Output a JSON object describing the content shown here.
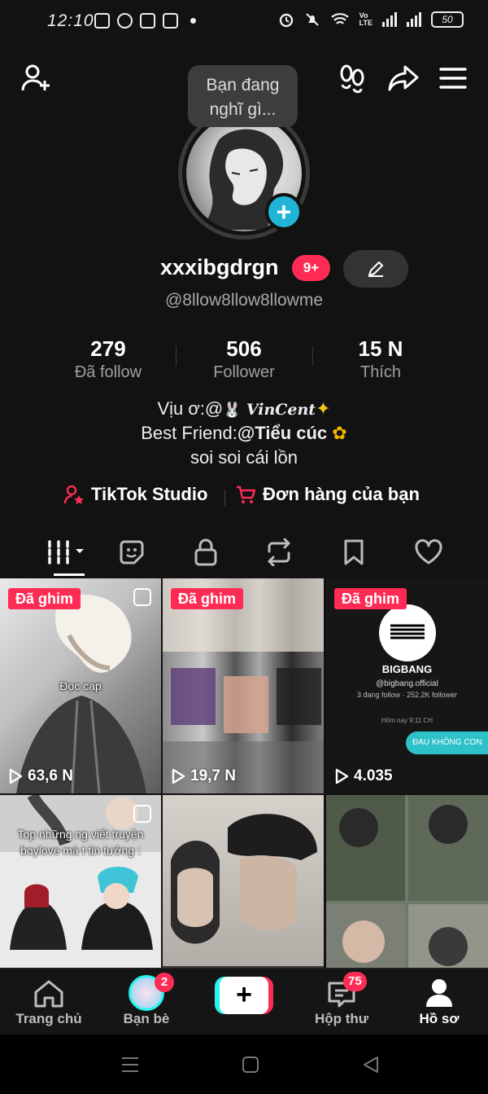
{
  "status_bar": {
    "time": "12:10",
    "volte": "Vo\nLTE",
    "battery": "50",
    "icons": [
      "chat-icon",
      "facebook-icon",
      "facebook-icon",
      "facebook-icon",
      "dot-icon",
      "alarm-icon",
      "mute-icon",
      "wifi-icon",
      "signal-icon",
      "signal-icon",
      "battery-icon"
    ]
  },
  "header": {
    "icons": [
      "add-friend-icon",
      "footprints-icon",
      "share-icon",
      "menu-icon"
    ],
    "tooltip_line1": "Bạn đang",
    "tooltip_line2": "nghĩ gì..."
  },
  "profile": {
    "username": "xxxibgdrgn",
    "notification_badge": "9+",
    "handle": "@8llow8llow8llowme"
  },
  "stats": {
    "following": {
      "value": "279",
      "label": "Đã follow"
    },
    "followers": {
      "value": "506",
      "label": "Follower"
    },
    "likes": {
      "value": "15 N",
      "label": "Thích"
    }
  },
  "bio": {
    "line1_prefix": "Vịu ơ:@",
    "line1_name": "VinCent",
    "line2_prefix": "Best Friend:",
    "line2_name": "@Tiểu cúc",
    "line3": "soi soi cái lồn"
  },
  "links": {
    "studio": "TikTok Studio",
    "orders": "Đơn hàng của bạn"
  },
  "tabs": [
    "videos-grid-icon",
    "sticker-icon",
    "lock-icon",
    "repost-icon",
    "bookmark-icon",
    "heart-icon"
  ],
  "videos": [
    {
      "pinned": "Đã ghim",
      "views": "63,6 N",
      "caption": "Đọc cap"
    },
    {
      "pinned": "Đã ghim",
      "views": "19,7 N"
    },
    {
      "pinned": "Đã ghim",
      "views": "4.035",
      "card_name": "BIGBANG",
      "card_handle": "@bigbang.official",
      "card_stats": "3 đang follow · 252.2K follower",
      "card_time": "Hôm nay 9:11 CH",
      "card_bubble": "ĐAU KHÔNG CON"
    },
    {
      "caption_line1": "Top những ng viết truyện",
      "caption_line2": "boylove mà t tin tưởng :"
    },
    {},
    {}
  ],
  "bottom_nav": {
    "home": "Trang chủ",
    "friends": "Bạn bè",
    "friends_badge": "2",
    "inbox": "Hộp thư",
    "inbox_badge": "75",
    "profile": "Hồ sơ",
    "create": "+"
  },
  "colors": {
    "accent_red": "#fe2c55",
    "accent_cyan": "#25f4ee",
    "add_button_blue": "#20b5d6",
    "background": "#121212"
  }
}
